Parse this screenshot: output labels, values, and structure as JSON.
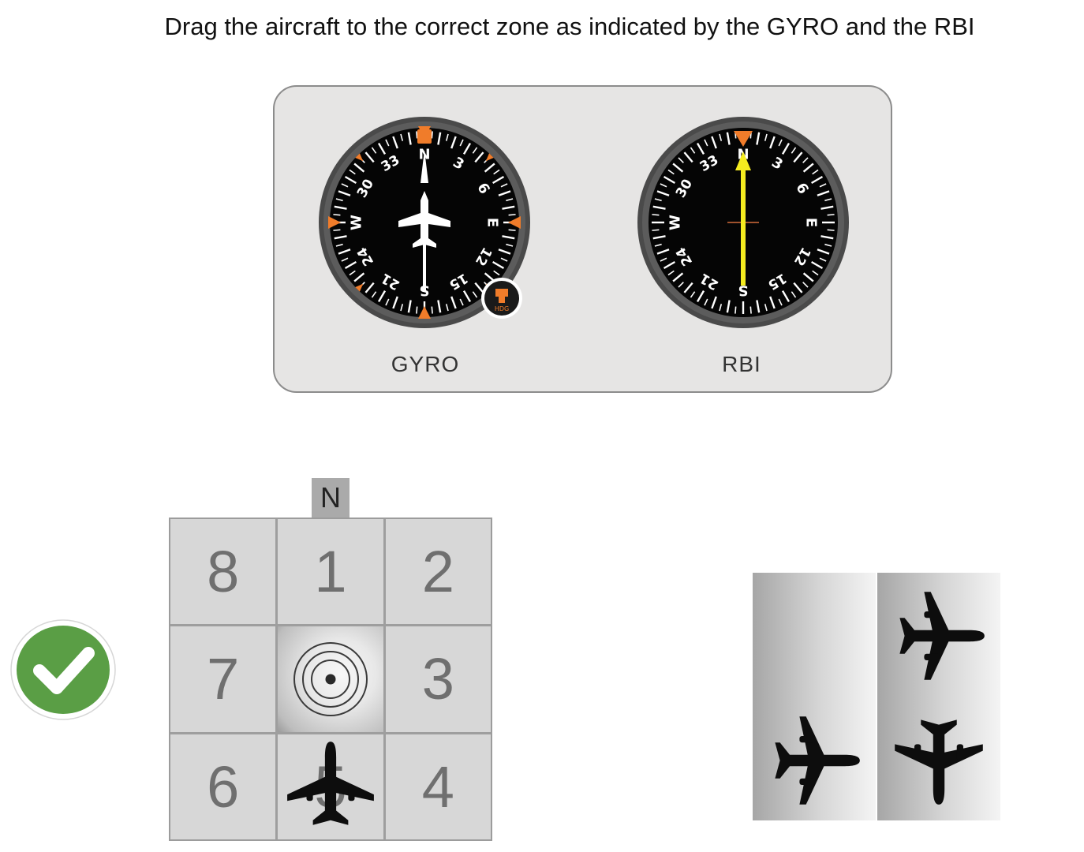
{
  "instruction": "Drag the aircraft to the correct zone as indicated by the GYRO and the RBI",
  "instruments": {
    "gyro_label": "GYRO",
    "rbi_label": "RBI",
    "gyro_heading_deg": 0,
    "rbi_relative_bearing_deg": 0,
    "hdg_knob_label": "HDG",
    "dial_labels": [
      "N",
      "3",
      "6",
      "E",
      "12",
      "15",
      "S",
      "21",
      "24",
      "W",
      "30",
      "33"
    ]
  },
  "zone_grid": {
    "north_label": "N",
    "zones": [
      "8",
      "1",
      "2",
      "7",
      "",
      "3",
      "6",
      "5",
      "4"
    ],
    "placed_aircraft_zone": "5"
  },
  "feedback": {
    "status": "correct",
    "icon": "checkmark-icon"
  },
  "aircraft_options": [
    {
      "heading": "east"
    },
    {
      "heading": "east"
    },
    {
      "heading": "south"
    }
  ],
  "colors": {
    "accent_orange": "#f07c2a",
    "needle_yellow": "#f5ec1f",
    "check_green": "#5a9e45",
    "panel_bg": "#e6e5e4"
  }
}
